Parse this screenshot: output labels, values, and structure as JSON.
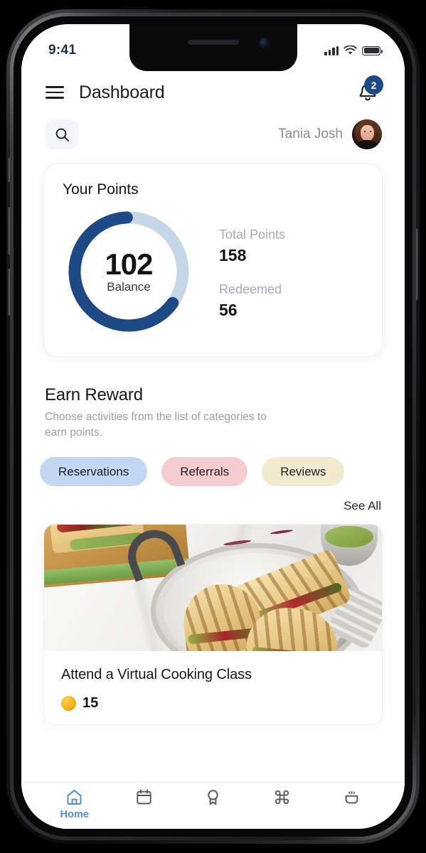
{
  "status_bar": {
    "time": "9:41",
    "signal_icon": "cellular-signal-icon",
    "wifi_icon": "wifi-icon",
    "battery_icon": "battery-icon"
  },
  "appbar": {
    "menu_icon": "hamburger-menu-icon",
    "title": "Dashboard",
    "bell_icon": "notification-bell-icon",
    "badge_count": "2"
  },
  "subbar": {
    "search_icon": "search-icon",
    "user_name": "Tania Josh",
    "avatar_icon": "user-avatar"
  },
  "points_card": {
    "title": "Your Points",
    "balance_value": "102",
    "balance_label": "Balance",
    "stats": [
      {
        "label": "Total Points",
        "value": "158"
      },
      {
        "label": "Redeemed",
        "value": "56"
      }
    ]
  },
  "earn": {
    "title": "Earn Reward",
    "subtitle": "Choose activities from the list of categories to earn points.",
    "chips": [
      {
        "label": "Reservations",
        "color": "#c3d6f2"
      },
      {
        "label": "Referrals",
        "color": "#f5ccd1"
      },
      {
        "label": "Reviews",
        "color": "#f2eacd"
      }
    ],
    "see_all": "See All"
  },
  "reward_card": {
    "image_alt": "grilled panini sandwiches in a pan with guacamole",
    "title": "Attend a Virtual Cooking Class",
    "points_icon": "coin-icon",
    "points": "15"
  },
  "bottom_nav": [
    {
      "icon": "home-icon",
      "label": "Home",
      "active": true
    },
    {
      "icon": "calendar-icon",
      "label": "",
      "active": false
    },
    {
      "icon": "award-medal-icon",
      "label": "",
      "active": false
    },
    {
      "icon": "command-offers-icon",
      "label": "",
      "active": false
    },
    {
      "icon": "food-bowl-icon",
      "label": "",
      "active": false
    }
  ],
  "chart_data": {
    "type": "pie",
    "title": "Your Points",
    "categories": [
      "Balance",
      "Redeemed"
    ],
    "values": [
      102,
      56
    ],
    "total": 158,
    "center_value": "102",
    "center_label": "Balance",
    "colors": [
      "#1d4a85",
      "#c5d6e7"
    ],
    "percent_filled": 64.6
  },
  "colors": {
    "accent_blue": "#1d4a85",
    "track_blue": "#c5d6e7",
    "nav_active": "#4f8fcb",
    "muted_text": "#a7a9ba"
  }
}
